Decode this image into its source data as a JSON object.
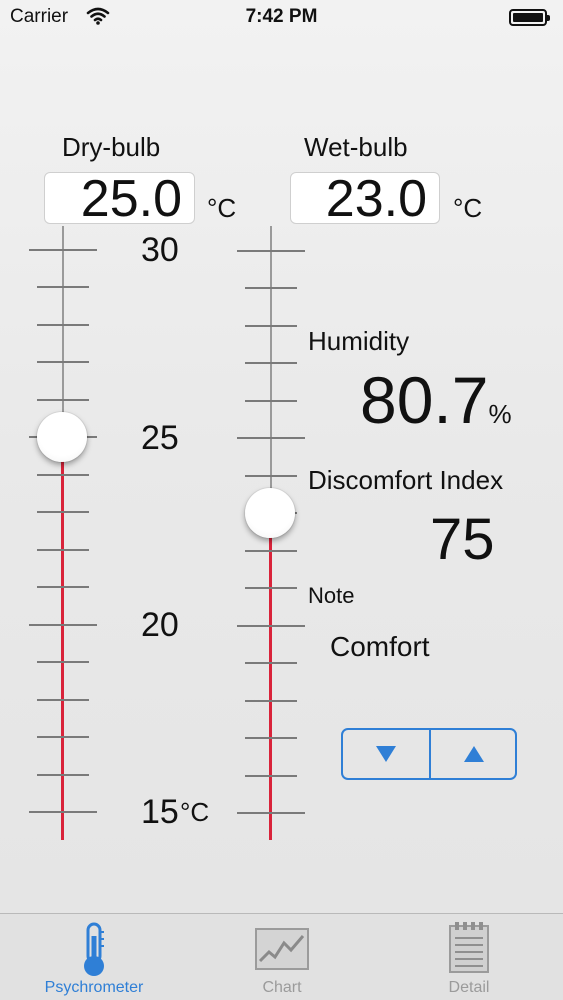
{
  "status_bar": {
    "carrier": "Carrier",
    "time": "7:42 PM"
  },
  "dry_bulb": {
    "label": "Dry-bulb",
    "value": "25.0",
    "unit": "°C",
    "scale_labels": [
      "30",
      "25",
      "20",
      "15"
    ],
    "bottom_unit": "°C",
    "scale_min": 15,
    "scale_max": 30,
    "current": 25.0
  },
  "wet_bulb": {
    "label": "Wet-bulb",
    "value": "23.0",
    "unit": "°C",
    "scale_min": 15,
    "scale_max": 30,
    "current": 23.0
  },
  "humidity": {
    "label": "Humidity",
    "value": "80.7",
    "unit": "%"
  },
  "discomfort": {
    "label": "Discomfort Index",
    "value": "75"
  },
  "note": {
    "label": "Note",
    "value": "Comfort"
  },
  "stepper": {
    "down_icon": "triangle-down-icon",
    "up_icon": "triangle-up-icon"
  },
  "tabs": [
    {
      "label": "Psychrometer",
      "icon": "thermometer-icon",
      "active": true
    },
    {
      "label": "Chart",
      "icon": "chart-icon",
      "active": false
    },
    {
      "label": "Detail",
      "icon": "document-icon",
      "active": false
    }
  ],
  "colors": {
    "accent": "#2f7fd6",
    "mercury": "#d9233a",
    "inactive": "#9b9b9b"
  }
}
